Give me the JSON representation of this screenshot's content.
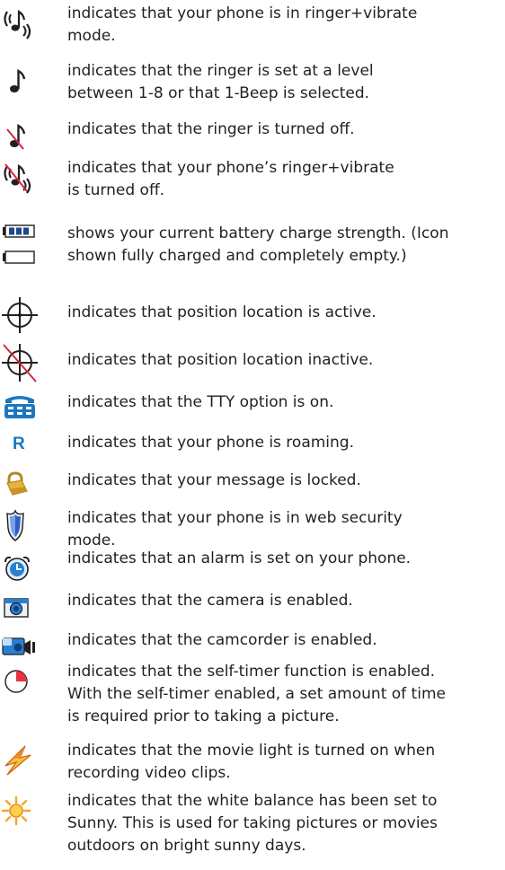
{
  "items": [
    {
      "icon": "ringer-vibrate-icon",
      "lines": [
        "indicates that your phone is in ringer+vibrate",
        "mode."
      ]
    },
    {
      "icon": "ringer-note-icon",
      "lines": [
        "indicates that the ringer is set at a level",
        "between 1-8 or that 1-Beep is selected."
      ]
    },
    {
      "icon": "ringer-off-icon",
      "lines": [
        "indicates that the ringer is turned off."
      ]
    },
    {
      "icon": "ringer-vibrate-off-icon",
      "lines": [
        "indicates that your phone’s ringer+vibrate",
        "is turned off."
      ]
    },
    {
      "icon": "battery-icon",
      "lines": [
        "shows your current battery charge strength. (Icon",
        "shown fully charged and completely empty.)"
      ]
    },
    {
      "icon": "location-on-icon",
      "lines": [
        "indicates that position location is active."
      ]
    },
    {
      "icon": "location-off-icon",
      "lines": [
        "indicates that position location inactive."
      ]
    },
    {
      "icon": "tty-icon",
      "lines": [
        "indicates that the TTY option is on."
      ]
    },
    {
      "icon": "roaming-icon",
      "icon_text": "R",
      "lines": [
        "indicates that your phone is roaming."
      ]
    },
    {
      "icon": "lock-icon",
      "lines": [
        "indicates that your message is locked."
      ]
    },
    {
      "icon": "security-shield-icon",
      "lines": [
        "indicates that your phone is in web security",
        "mode."
      ]
    },
    {
      "icon": "alarm-clock-icon",
      "lines": [
        "indicates that an alarm is set on your phone."
      ]
    },
    {
      "icon": "camera-icon",
      "lines": [
        "indicates that the camera is enabled."
      ]
    },
    {
      "icon": "camcorder-icon",
      "lines": [
        "indicates that the camcorder is enabled."
      ]
    },
    {
      "icon": "self-timer-icon",
      "lines": [
        "indicates that the self-timer function is enabled.",
        "With the self-timer enabled, a set amount of time",
        "is required prior to taking a picture."
      ]
    },
    {
      "icon": "movie-light-icon",
      "lines": [
        "indicates that the movie light is turned on when",
        "recording video clips."
      ]
    },
    {
      "icon": "sunny-icon",
      "lines": [
        "indicates that the white balance has been set to",
        "Sunny. This is used for taking pictures or movies",
        "outdoors on bright sunny days."
      ]
    }
  ],
  "colors": {
    "text": "#231f20",
    "accent_blue": "#1a78c2",
    "strike_red": "#d7263d",
    "lock_gold": "#e8b33a",
    "sun_orange": "#f5a623",
    "bolt_orange": "#f08a24"
  }
}
